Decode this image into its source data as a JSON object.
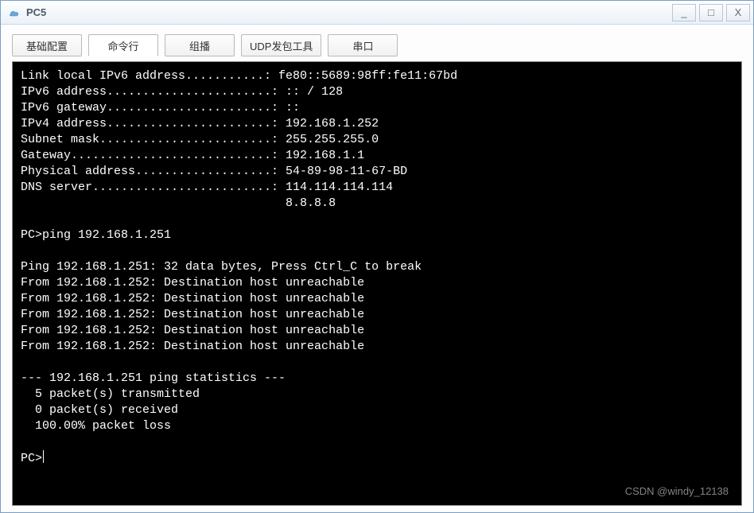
{
  "window": {
    "title": "PC5",
    "minimize_label": "_",
    "maximize_label": "□",
    "close_label": "X"
  },
  "tabs": [
    {
      "label": "基础配置"
    },
    {
      "label": "命令行"
    },
    {
      "label": "组播"
    },
    {
      "label": "UDP发包工具"
    },
    {
      "label": "串口"
    }
  ],
  "active_tab_index": 1,
  "terminal": {
    "lines": [
      "Link local IPv6 address...........: fe80::5689:98ff:fe11:67bd",
      "IPv6 address.......................: :: / 128",
      "IPv6 gateway.......................: ::",
      "IPv4 address.......................: 192.168.1.252",
      "Subnet mask........................: 255.255.255.0",
      "Gateway............................: 192.168.1.1",
      "Physical address...................: 54-89-98-11-67-BD",
      "DNS server.........................: 114.114.114.114",
      "                                     8.8.8.8",
      "",
      "PC>ping 192.168.1.251",
      "",
      "Ping 192.168.1.251: 32 data bytes, Press Ctrl_C to break",
      "From 192.168.1.252: Destination host unreachable",
      "From 192.168.1.252: Destination host unreachable",
      "From 192.168.1.252: Destination host unreachable",
      "From 192.168.1.252: Destination host unreachable",
      "From 192.168.1.252: Destination host unreachable",
      "",
      "--- 192.168.1.251 ping statistics ---",
      "  5 packet(s) transmitted",
      "  0 packet(s) received",
      "  100.00% packet loss",
      ""
    ],
    "prompt": "PC>"
  },
  "watermark": "CSDN @windy_12138"
}
